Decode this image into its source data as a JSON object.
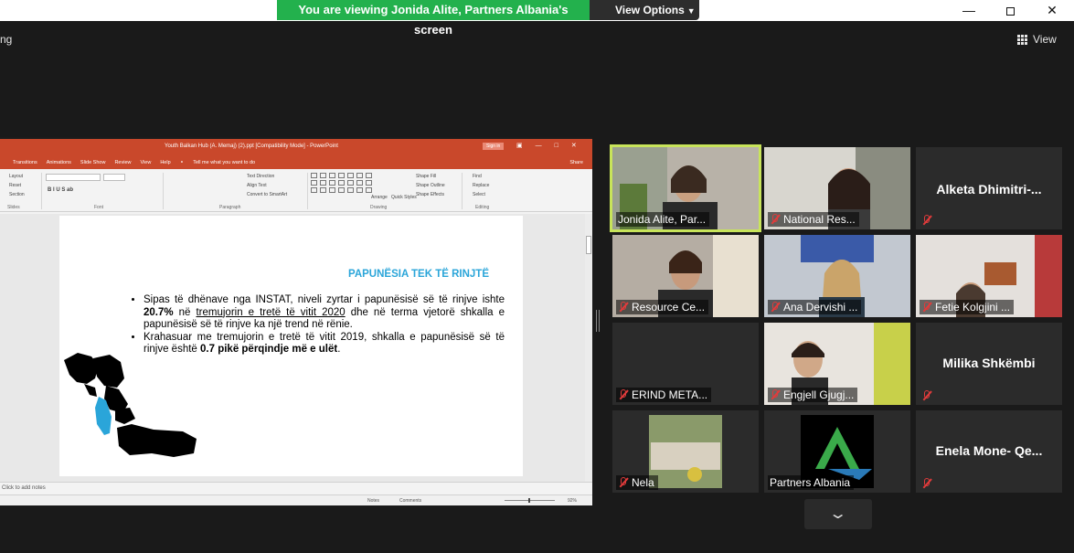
{
  "window": {
    "share_banner": "You are viewing Jonida Alite, Partners Albania's screen",
    "view_options": "View Options",
    "left_label": "ng",
    "view_label": "View"
  },
  "ppt": {
    "title": "Youth Balkan Hub (A. Memaj) (2).ppt [Compatibility Mode] - PowerPoint",
    "signin": "Sign in",
    "menu": [
      "Transitions",
      "Animations",
      "Slide Show",
      "Review",
      "View",
      "Help"
    ],
    "tell_me": "Tell me what you want to do",
    "share": "Share",
    "ribbon": {
      "layout": "Layout",
      "reset": "Reset",
      "section": "Section",
      "slides_group": "Slides",
      "font_group": "Font",
      "paragraph_group": "Paragraph",
      "drawing_group": "Drawing",
      "editing_group": "Editing",
      "text_direction": "Text Direction",
      "align_text": "Align Text",
      "convert_smartart": "Convert to SmartArt",
      "arrange": "Arrange",
      "quick_styles": "Quick Styles",
      "shape_fill": "Shape Fill",
      "shape_outline": "Shape Outline",
      "shape_effects": "Shape Effects",
      "find": "Find",
      "replace": "Replace",
      "select": "Select"
    },
    "slide": {
      "title": "PAPUNËSIA TEK TË RINJTË",
      "b1_a": "Sipas të dhënave nga INSTAT, niveli zyrtar i papunësisë së të rinjve ishte ",
      "b1_b": "20.7%",
      "b1_c": " në ",
      "b1_d": "tremujorin e tretë të vitit 2020",
      "b1_e": " dhe në terma vjetorë shkalla e papunësisë së të rinjve ka një trend në rënie.",
      "b2_a": "Krahasuar me tremujorin e tretë të vitit 2019, shkalla e papunësisë së të rinjve është ",
      "b2_b": "0.7 pikë përqindje më e ulët",
      "b2_c": "."
    },
    "notes_placeholder": "Click to add notes",
    "status_notes": "Notes",
    "status_comments": "Comments",
    "zoom": "92%"
  },
  "participants": [
    {
      "name": "Jonida Alite, Par...",
      "muted": false,
      "active": true,
      "video": true
    },
    {
      "name": "National Res...",
      "muted": true,
      "video": true
    },
    {
      "name": "Alketa  Dhimitri-...",
      "muted": true,
      "video": false
    },
    {
      "name": "Resource Ce...",
      "muted": true,
      "video": true
    },
    {
      "name": "Ana Dervishi ...",
      "muted": true,
      "video": true
    },
    {
      "name": "Fetie Kolgjini ...",
      "muted": true,
      "video": true
    },
    {
      "name": "ERIND META...",
      "muted": true,
      "video": false
    },
    {
      "name": "Engjell Gjugj...",
      "muted": true,
      "video": true
    },
    {
      "name": "Milika Shkëmbi",
      "muted": true,
      "video": false
    },
    {
      "name": "Nela",
      "muted": true,
      "video": true
    },
    {
      "name": "Partners Albania",
      "muted": false,
      "video": true
    },
    {
      "name": "Enela Mone- Qe...",
      "muted": true,
      "video": false
    }
  ],
  "colors": {
    "banner_green": "#23b14d",
    "ppt_red": "#c9482b",
    "active_border": "#c8e45a",
    "mute_red": "#e23b3b",
    "slide_title": "#2aa5d9"
  }
}
